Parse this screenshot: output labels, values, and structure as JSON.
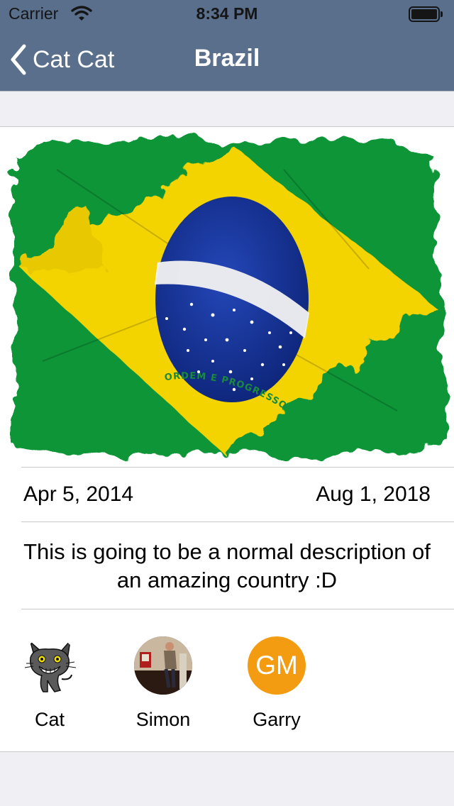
{
  "status_bar": {
    "carrier": "Carrier",
    "time": "8:34 PM",
    "icons": [
      "wifi-icon",
      "battery-icon"
    ]
  },
  "nav": {
    "back_label": "Cat Cat",
    "title": "Brazil",
    "back_icon": "chevron-left-icon",
    "bar_color": "#5a6f8c"
  },
  "country": {
    "image": "brazil-flag",
    "flag_motto": "ORDEM E PROGRESSO",
    "start_date": "Apr 5, 2014",
    "end_date": "Aug 1, 2018",
    "description": "This is going to be a normal description of an amazing country :D"
  },
  "members": [
    {
      "name": "Cat",
      "avatar": "cat-cartoon"
    },
    {
      "name": "Simon",
      "avatar": "photo"
    },
    {
      "name": "Garry",
      "avatar": "initials",
      "initials": "GM",
      "color": "#f39c12"
    }
  ]
}
